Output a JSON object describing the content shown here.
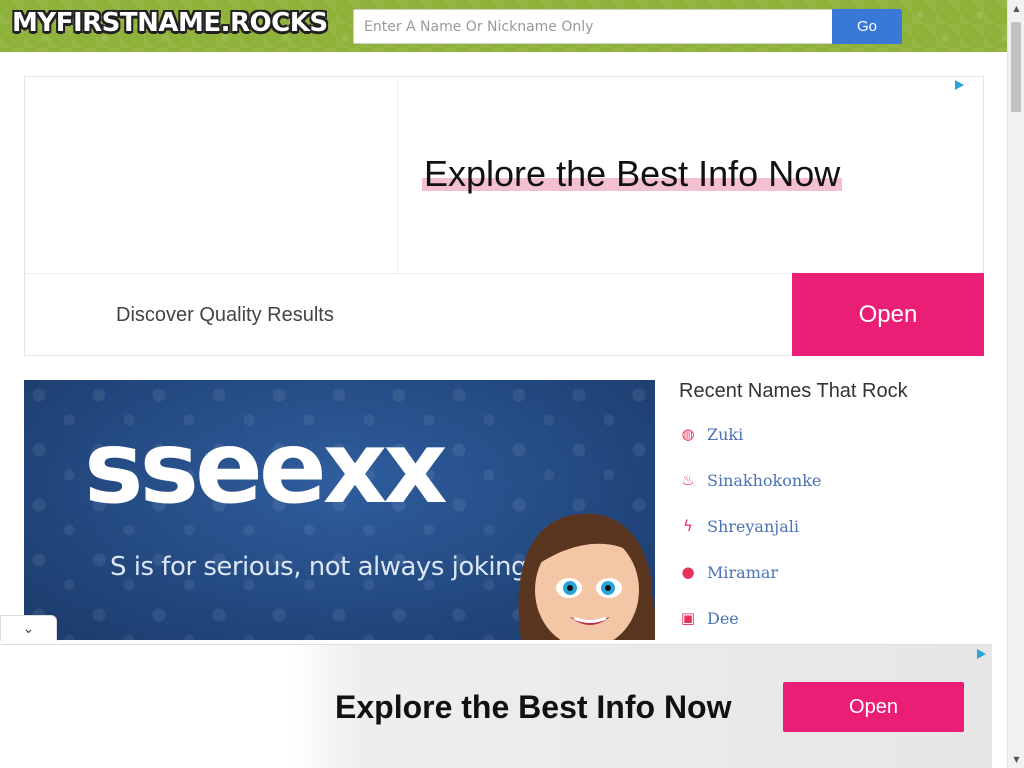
{
  "header": {
    "logo": "MYFIRSTNAME.ROCKS",
    "search_placeholder": "Enter A Name Or Nickname Only",
    "go_label": "Go"
  },
  "ad_top": {
    "headline": "Explore the Best Info Now",
    "subtext": "Discover Quality Results",
    "open_label": "Open",
    "accent_color": "#e91e74"
  },
  "hero": {
    "name": "sseexx",
    "tagline": "S is for serious, not always joking."
  },
  "recent": {
    "title": "Recent Names That Rock",
    "items": [
      {
        "icon": "basketball-icon",
        "label": "Zuki"
      },
      {
        "icon": "cake-icon",
        "label": "Sinakhokonke"
      },
      {
        "icon": "lightning-icon",
        "label": "Shreyanjali"
      },
      {
        "icon": "bomb-icon",
        "label": "Miramar"
      },
      {
        "icon": "bus-icon",
        "label": "Dee"
      }
    ]
  },
  "ad_bottom": {
    "headline": "Explore the Best Info Now",
    "open_label": "Open"
  },
  "colors": {
    "header_green": "#8fb33a",
    "link_blue": "#4a72b8",
    "go_blue": "#3a78d8",
    "icon_red": "#e8305a"
  }
}
